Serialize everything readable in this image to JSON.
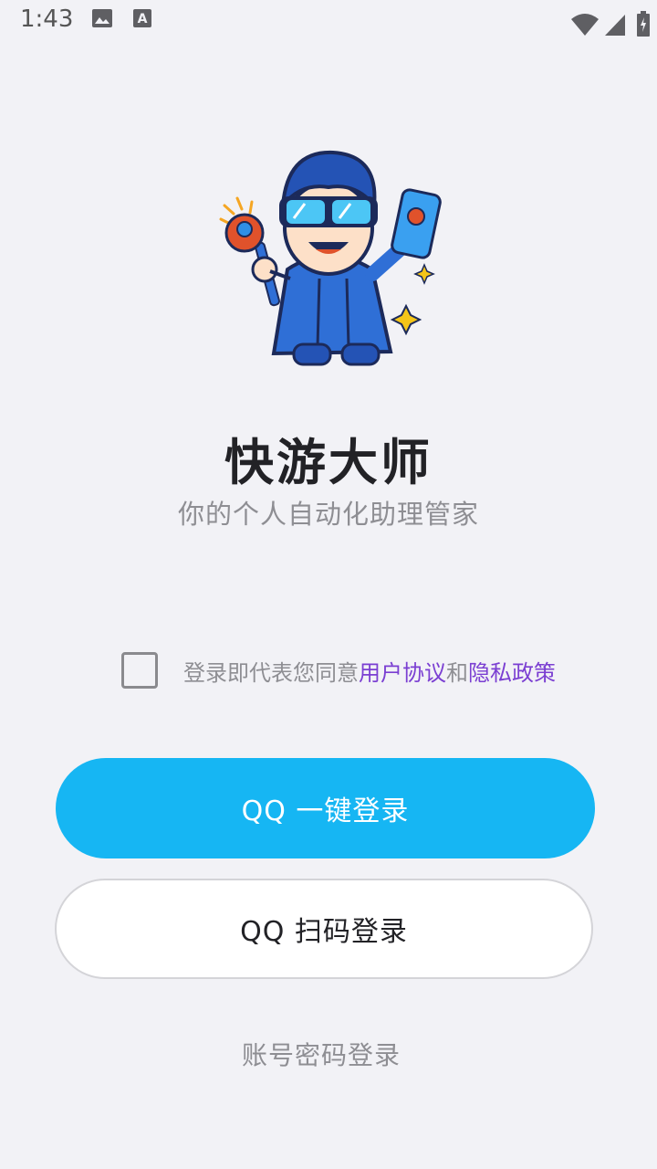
{
  "status_bar": {
    "time": "1:43",
    "icons": [
      "image-icon",
      "a-notification-icon",
      "wifi-icon",
      "cell-signal-icon",
      "battery-charging-icon"
    ]
  },
  "mascot": {
    "icon": "mascot-illustration"
  },
  "app": {
    "title": "快游大师",
    "subtitle": "你的个人自动化助理管家"
  },
  "agreement": {
    "checked": false,
    "prefix": "登录即代表您同意",
    "user_agreement": "用户协议",
    "and": "和",
    "privacy_policy": "隐私政策",
    "link_color": "#7b3fd2"
  },
  "buttons": {
    "qq_one_click": "QQ 一键登录",
    "qq_scan": "QQ 扫码登录",
    "account_login": "账号密码登录",
    "primary_color": "#16b6f3"
  }
}
